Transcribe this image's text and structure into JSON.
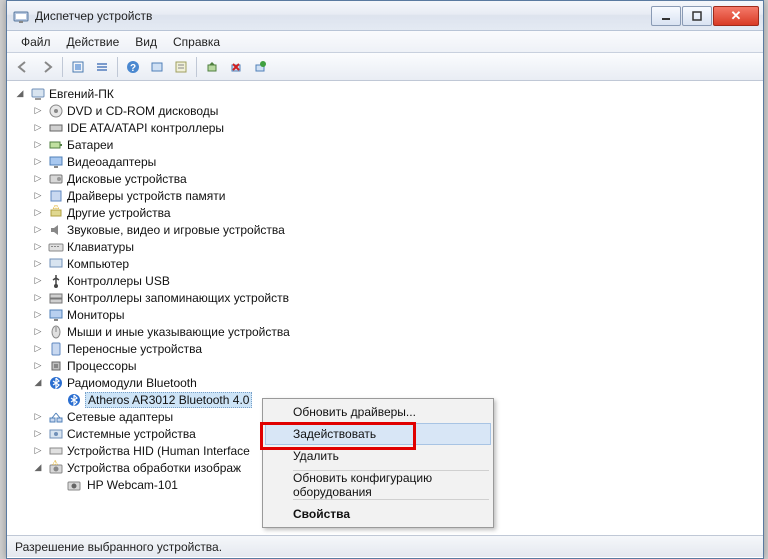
{
  "window": {
    "title": "Диспетчер устройств"
  },
  "menubar": {
    "file": "Файл",
    "action": "Действие",
    "view": "Вид",
    "help": "Справка"
  },
  "tree": {
    "root": "Евгений-ПК",
    "items": [
      {
        "label": "DVD и CD-ROM дисководы",
        "icon": "disc"
      },
      {
        "label": "IDE ATA/ATAPI контроллеры",
        "icon": "ide"
      },
      {
        "label": "Батареи",
        "icon": "battery"
      },
      {
        "label": "Видеоадаптеры",
        "icon": "display"
      },
      {
        "label": "Дисковые устройства",
        "icon": "disk"
      },
      {
        "label": "Драйверы устройств памяти",
        "icon": "memdriver"
      },
      {
        "label": "Другие устройства",
        "icon": "other"
      },
      {
        "label": "Звуковые, видео и игровые устройства",
        "icon": "sound"
      },
      {
        "label": "Клавиатуры",
        "icon": "keyboard"
      },
      {
        "label": "Компьютер",
        "icon": "computer"
      },
      {
        "label": "Контроллеры USB",
        "icon": "usb"
      },
      {
        "label": "Контроллеры запоминающих устройств",
        "icon": "storage"
      },
      {
        "label": "Мониторы",
        "icon": "monitor"
      },
      {
        "label": "Мыши и иные указывающие устройства",
        "icon": "mouse"
      },
      {
        "label": "Переносные устройства",
        "icon": "portable"
      },
      {
        "label": "Процессоры",
        "icon": "cpu"
      },
      {
        "label": "Радиомодули Bluetooth",
        "icon": "bluetooth",
        "expanded": true,
        "children": [
          {
            "label": "Atheros AR3012 Bluetooth 4.0",
            "icon": "bluetooth",
            "selected": true
          }
        ]
      },
      {
        "label": "Сетевые адаптеры",
        "icon": "network"
      },
      {
        "label": "Системные устройства",
        "icon": "system"
      },
      {
        "label": "Устройства HID (Human Interface",
        "icon": "hid"
      },
      {
        "label": "Устройства обработки изображ",
        "icon": "imaging",
        "expanded": true,
        "children": [
          {
            "label": "HP Webcam-101",
            "icon": "camera"
          }
        ]
      }
    ]
  },
  "context_menu": {
    "update_drivers": "Обновить драйверы...",
    "enable": "Задействовать",
    "delete": "Удалить",
    "scan_hardware": "Обновить конфигурацию оборудования",
    "properties": "Свойства"
  },
  "statusbar": {
    "text": "Разрешение выбранного устройства."
  }
}
